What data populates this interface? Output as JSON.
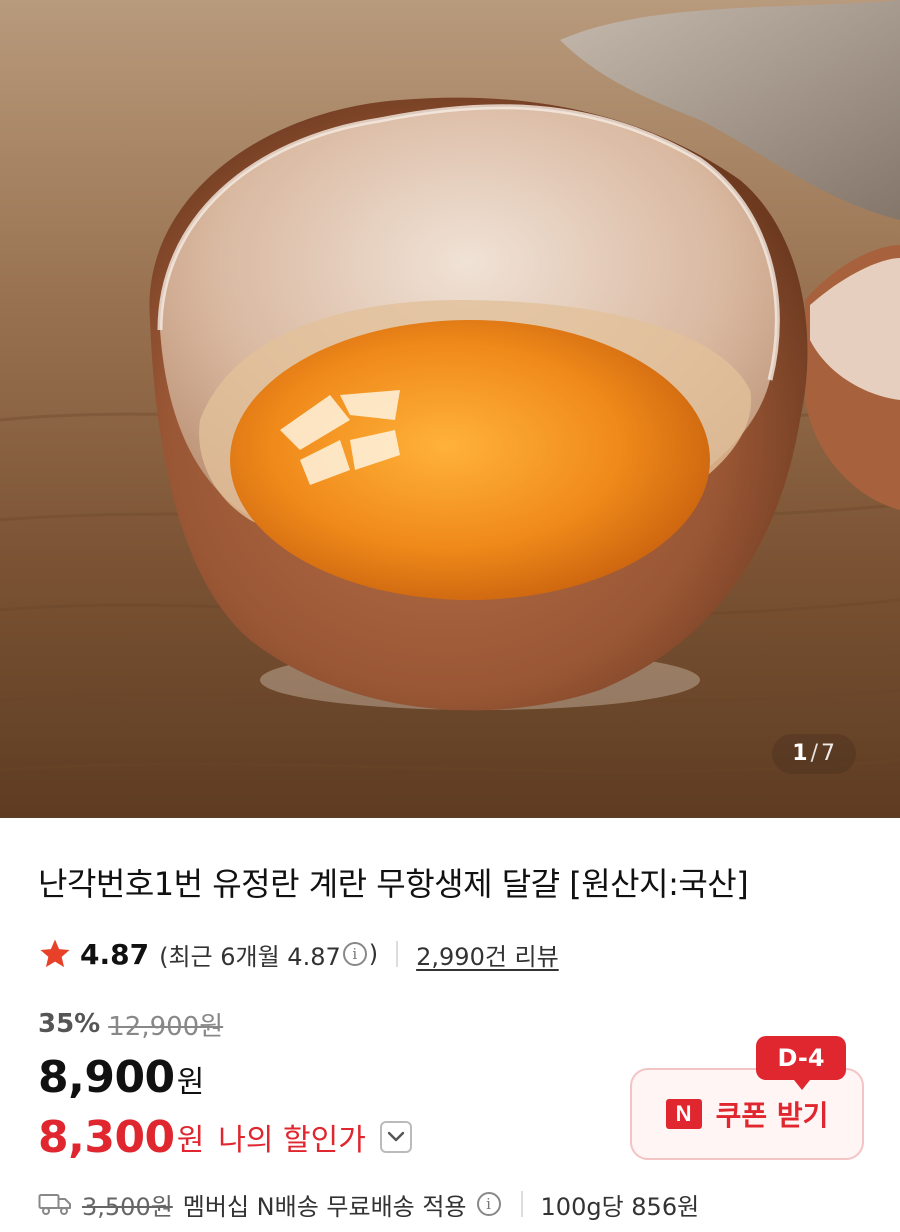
{
  "gallery": {
    "current": "1",
    "separator": "/",
    "total": "7"
  },
  "product": {
    "title": "난각번호1번 유정란 계란 무항생제 달걀 [원산지:국산]"
  },
  "rating": {
    "score": "4.87",
    "recent_open": "(최근 6개월 4.87",
    "recent_close": ")",
    "review_count": "2,990건 리뷰"
  },
  "pricing": {
    "discount_percent": "35%",
    "original_price": "12,900원",
    "price_number": "8,900",
    "price_unit": "원",
    "my_price_number": "8,300",
    "my_price_unit": "원",
    "my_price_label": "나의 할인가"
  },
  "coupon": {
    "d_day": "D-4",
    "badge": "N",
    "label": "쿠폰 받기"
  },
  "shipping": {
    "original_fee": "3,500원",
    "description": "멤버십 N배송 무료배송 적용",
    "unit_price": "100g당 856원"
  },
  "colors": {
    "accent_red": "#e0262e",
    "star": "#e8412a"
  }
}
